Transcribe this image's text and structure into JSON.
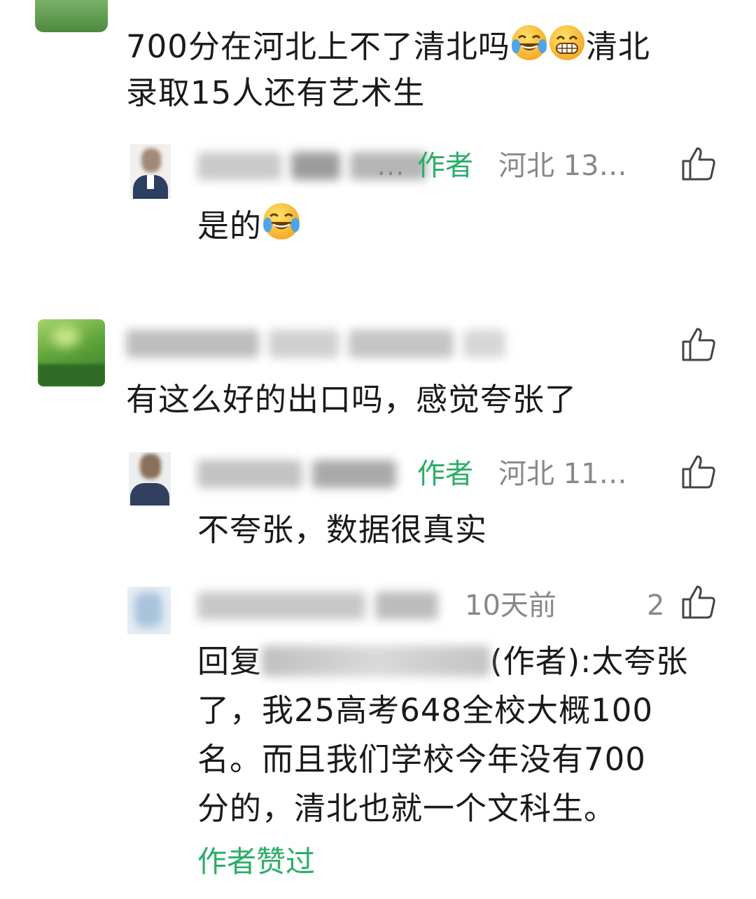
{
  "comments": [
    {
      "text": "700分在河北上不了清北吗",
      "text2": "清北",
      "line2": "录取15人还有艺术生",
      "emoji": [
        "grinning-face-with-tears-emoji",
        "grinning-face-emoji"
      ],
      "replies": [
        {
          "author_tag": "作者",
          "meta": "河北 13…",
          "text": "是的",
          "emoji": "grinning-face-with-tears-emoji"
        }
      ]
    },
    {
      "text": "有这么好的出口吗，感觉夸张了",
      "replies": [
        {
          "author_tag": "作者",
          "meta": "河北 11…",
          "text": "不夸张，数据很真实"
        },
        {
          "meta": "10天前",
          "likes": "2",
          "reply_prefix": "回复",
          "reply_author_suffix": "(作者):太夸张",
          "lines": [
            "了，我25高考648全校大概100",
            "名。而且我们学校今年没有700",
            "分的，清北也就一个文科生。"
          ],
          "liked_by_author": "作者赞过"
        }
      ]
    }
  ],
  "colors": {
    "author_green": "#2aae67",
    "meta_gray": "#888888",
    "text": "#1a1a1a"
  }
}
